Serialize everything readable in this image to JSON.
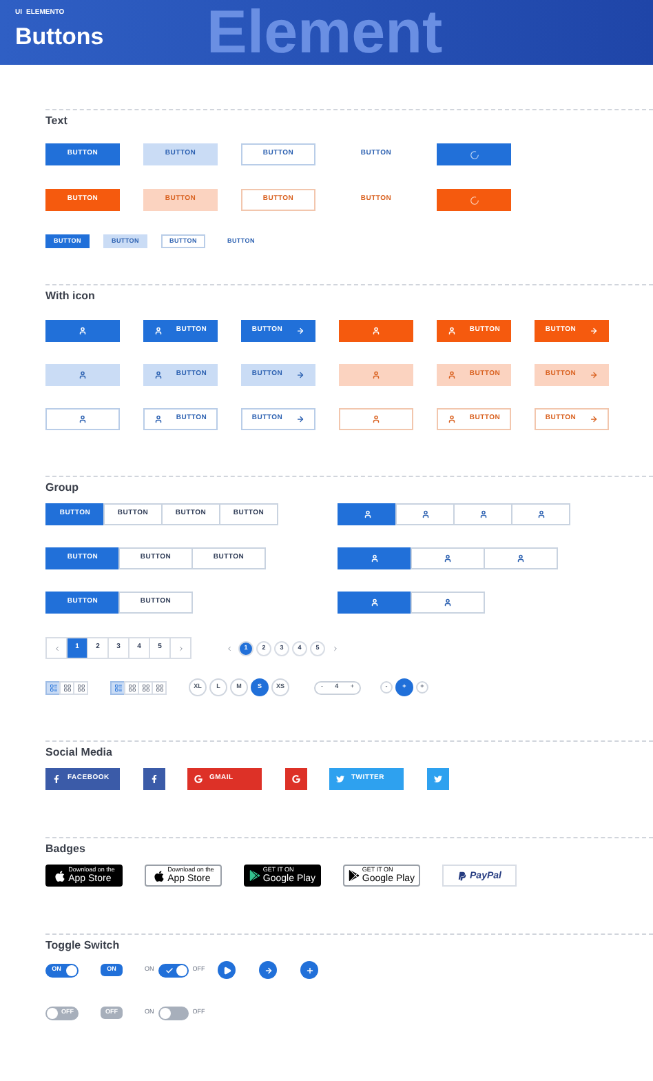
{
  "header": {
    "brand": "UI",
    "brand_name": "ELEMENTO",
    "title": "Buttons",
    "backdrop_text": "Element"
  },
  "text_section": {
    "title": "Text",
    "rows": [
      {
        "kind": "blue",
        "buttons": [
          {
            "kind": "solid",
            "label": "BUTTON"
          },
          {
            "kind": "soft",
            "label": "BUTTON"
          },
          {
            "kind": "outline",
            "label": "BUTTON"
          },
          {
            "kind": "ghost",
            "label": "BUTTON"
          },
          {
            "kind": "loading"
          }
        ]
      },
      {
        "kind": "orange",
        "buttons": [
          {
            "kind": "solid",
            "label": "BUTTON"
          },
          {
            "kind": "soft",
            "label": "BUTTON"
          },
          {
            "kind": "outline",
            "label": "BUTTON"
          },
          {
            "kind": "ghost",
            "label": "BUTTON"
          },
          {
            "kind": "loading"
          }
        ]
      },
      {
        "kind": "small",
        "buttons": [
          {
            "kind": "solid",
            "label": "BUTTON"
          },
          {
            "kind": "soft",
            "label": "BUTTON"
          },
          {
            "kind": "outline",
            "label": "BUTTON"
          },
          {
            "kind": "ghost",
            "label": "BUTTON"
          }
        ]
      }
    ]
  },
  "icon_section": {
    "title": "With icon",
    "rows": [
      {
        "kind": "solid",
        "buttons": [
          {
            "kind": "icon"
          },
          {
            "kind": "icon_label",
            "label": "BUTTON"
          },
          {
            "kind": "label_arrow",
            "label": "BUTTON"
          },
          {
            "kind": "icon"
          },
          {
            "kind": "icon_label",
            "label": "BUTTON"
          },
          {
            "kind": "label_arrow",
            "label": "BUTTON"
          }
        ]
      },
      {
        "kind": "soft",
        "buttons": [
          {
            "kind": "icon"
          },
          {
            "kind": "icon_label",
            "label": "BUTTON"
          },
          {
            "kind": "label_arrow",
            "label": "BUTTON"
          },
          {
            "kind": "icon"
          },
          {
            "kind": "icon_label",
            "label": "BUTTON"
          },
          {
            "kind": "label_arrow",
            "label": "BUTTON"
          }
        ]
      },
      {
        "kind": "outline",
        "buttons": [
          {
            "kind": "icon"
          },
          {
            "kind": "icon_label",
            "label": "BUTTON"
          },
          {
            "kind": "label_arrow",
            "label": "BUTTON"
          },
          {
            "kind": "icon"
          },
          {
            "kind": "icon_label",
            "label": "BUTTON"
          },
          {
            "kind": "label_arrow",
            "label": "BUTTON"
          }
        ]
      }
    ]
  },
  "group_section": {
    "title": "Group",
    "button_groups": [
      {
        "items": [
          {
            "label": "BUTTON",
            "selected": true
          },
          {
            "label": "BUTTON",
            "selected": false
          },
          {
            "label": "BUTTON",
            "selected": false
          },
          {
            "label": "BUTTON",
            "selected": false
          }
        ]
      },
      {
        "items": [
          {
            "label": "BUTTON",
            "selected": true
          },
          {
            "label": "BUTTON",
            "selected": false
          },
          {
            "label": "BUTTON",
            "selected": false
          }
        ]
      },
      {
        "items": [
          {
            "label": "BUTTON",
            "selected": true
          },
          {
            "label": "BUTTON",
            "selected": false
          }
        ]
      }
    ],
    "icon_groups": [
      {
        "items": [
          {
            "selected": true
          },
          {
            "selected": false
          },
          {
            "selected": false
          },
          {
            "selected": false
          }
        ]
      },
      {
        "items": [
          {
            "selected": true
          },
          {
            "selected": false
          },
          {
            "selected": false
          }
        ]
      },
      {
        "items": [
          {
            "selected": true
          },
          {
            "selected": false
          }
        ]
      }
    ],
    "paginations": [
      {
        "kind": "boxed",
        "pages": [
          {
            "label": "1",
            "selected": true
          },
          {
            "label": "2",
            "selected": false
          },
          {
            "label": "3",
            "selected": false
          },
          {
            "label": "4",
            "selected": false
          },
          {
            "label": "5",
            "selected": false
          }
        ]
      },
      {
        "kind": "round",
        "pages": [
          {
            "label": "1",
            "selected": true
          },
          {
            "label": "2",
            "selected": false
          },
          {
            "label": "3",
            "selected": false
          },
          {
            "label": "4",
            "selected": false
          },
          {
            "label": "5",
            "selected": false
          }
        ]
      }
    ],
    "view_toggles": [
      {
        "items": [
          {
            "kind": "list",
            "selected": true
          },
          {
            "kind": "grid",
            "selected": false
          },
          {
            "kind": "grid",
            "selected": false
          }
        ]
      },
      {
        "items": [
          {
            "kind": "list",
            "selected": true
          },
          {
            "kind": "grid",
            "selected": false
          },
          {
            "kind": "grid",
            "selected": false
          },
          {
            "kind": "grid",
            "selected": false
          }
        ]
      }
    ],
    "sizes": [
      {
        "label": "XL",
        "selected": false
      },
      {
        "label": "L",
        "selected": false
      },
      {
        "label": "M",
        "selected": false
      },
      {
        "label": "S",
        "selected": true
      },
      {
        "label": "XS",
        "selected": false
      }
    ],
    "stepper": {
      "minus": "-",
      "value": "4",
      "plus": "+"
    },
    "round_stepper": [
      {
        "label": "-",
        "selected": false
      },
      {
        "label": "+",
        "selected": true
      },
      {
        "label": "+",
        "selected": false
      }
    ]
  },
  "social_section": {
    "title": "Social Media",
    "buttons": [
      {
        "kind": "facebook",
        "label": "FACEBOOK",
        "color": "#3b5ba8"
      },
      {
        "kind": "facebook",
        "color": "#3b5ba8"
      },
      {
        "kind": "google",
        "label": "GMAIL",
        "color": "#dd3127"
      },
      {
        "kind": "google",
        "color": "#dd3127"
      },
      {
        "kind": "twitter",
        "label": "TWITTER",
        "color": "#2ea1ef"
      },
      {
        "kind": "twitter",
        "color": "#2ea1ef"
      }
    ]
  },
  "badges_section": {
    "title": "Badges",
    "badges": [
      {
        "kind": "app_store_dark",
        "small": "Download on the",
        "big": "App Store"
      },
      {
        "kind": "app_store_light",
        "small": "Download on the",
        "big": "App Store"
      },
      {
        "kind": "google_play_dark",
        "small": "GET IT ON",
        "big": "Google Play"
      },
      {
        "kind": "google_play_light",
        "small": "GET IT ON",
        "big": "Google Play"
      },
      {
        "kind": "paypal",
        "big": "PayPal"
      }
    ]
  },
  "toggle_section": {
    "title": "Toggle Switch",
    "rows": [
      {
        "toggles": [
          {
            "kind": "switch",
            "on": true,
            "label": "ON"
          },
          {
            "kind": "tab",
            "on": true,
            "label": "ON"
          },
          {
            "kind": "labeled",
            "on": true,
            "left": "ON",
            "right": "OFF"
          }
        ],
        "round_buttons": [
          {
            "kind": "play"
          },
          {
            "kind": "arrow"
          },
          {
            "kind": "plus"
          }
        ]
      },
      {
        "toggles": [
          {
            "kind": "switch",
            "on": false,
            "label": "OFF"
          },
          {
            "kind": "tab",
            "on": false,
            "label": "OFF"
          },
          {
            "kind": "labeled",
            "on": false,
            "left": "ON",
            "right": "OFF"
          }
        ]
      }
    ]
  }
}
